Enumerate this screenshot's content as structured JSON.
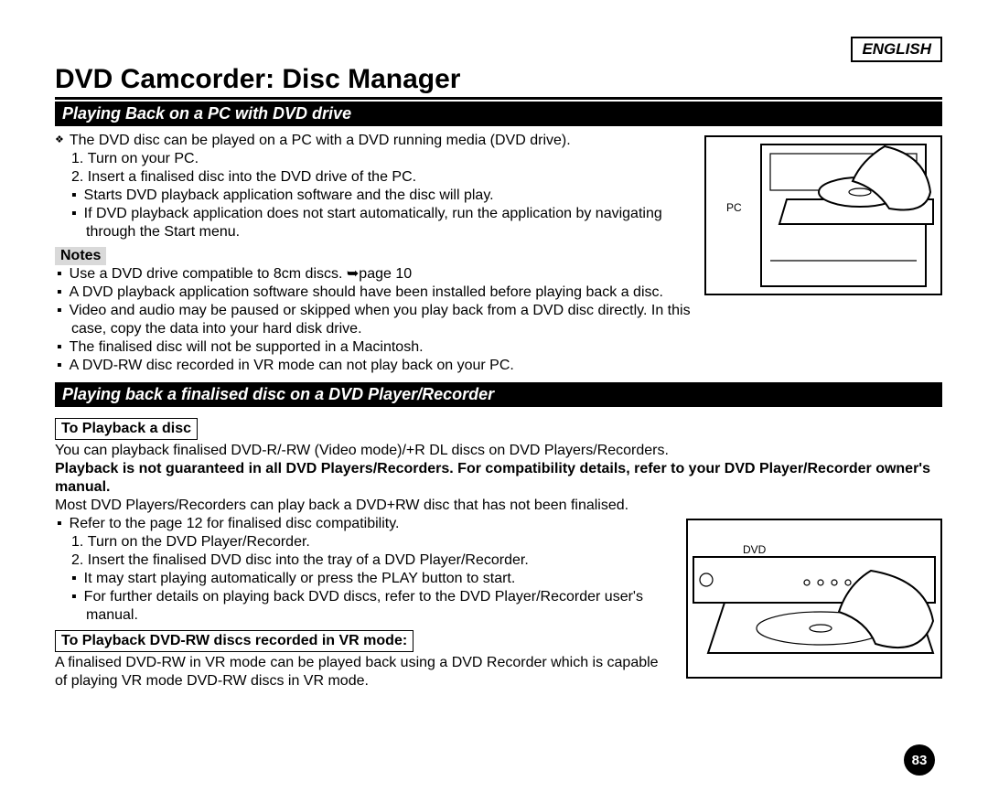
{
  "lang": "ENGLISH",
  "title": "DVD Camcorder: Disc Manager",
  "section1": {
    "heading": "Playing Back on a PC with DVD drive",
    "intro": "The DVD disc can be played on a PC with a DVD running media (DVD drive).",
    "step1": "Turn on your PC.",
    "step2": "Insert a finalised disc into the DVD drive of the PC.",
    "sub1": "Starts DVD playback application software and the disc will play.",
    "sub2": "If DVD playback application does not start automatically, run the application by navigating through the Start menu.",
    "notes_label": "Notes",
    "note1": "Use a DVD drive compatible to 8cm discs. ➥page 10",
    "note2": "A DVD playback application software should have been installed before playing back a disc.",
    "note3": "Video and audio may be paused or skipped when you play back from a DVD disc directly. In this case, copy the data into your hard disk drive.",
    "note4": "The finalised disc will not be supported in a Macintosh.",
    "note5": "A DVD-RW disc recorded in VR mode can not play back on your PC.",
    "illus_label": "PC"
  },
  "section2": {
    "heading": "Playing back a finalised disc on a DVD Player/Recorder",
    "sub_a": "To Playback a disc",
    "p1": "You can playback finalised DVD-R/-RW (Video mode)/+R DL discs on DVD Players/Recorders.",
    "p2": "Playback is not guaranteed in all DVD Players/Recorders. For compatibility details, refer to your DVD Player/Recorder owner's manual.",
    "p3": "Most DVD Players/Recorders can play back a DVD+RW disc that has not been finalised.",
    "bullet1": "Refer to the page 12 for finalised disc compatibility.",
    "step1": "Turn on the DVD Player/Recorder.",
    "step2": "Insert the finalised DVD disc into the tray of a DVD Player/Recorder.",
    "sub1": "It may start playing automatically or press the PLAY button to start.",
    "sub2": "For further details on playing back DVD discs, refer to the DVD Player/Recorder user's manual.",
    "sub_b": "To Playback DVD-RW discs recorded in VR mode:",
    "p4": "A finalised DVD-RW in VR mode can be played back using a DVD Recorder which is capable of playing VR mode DVD-RW discs in VR mode.",
    "illus_label": "DVD"
  },
  "page_number": "83"
}
